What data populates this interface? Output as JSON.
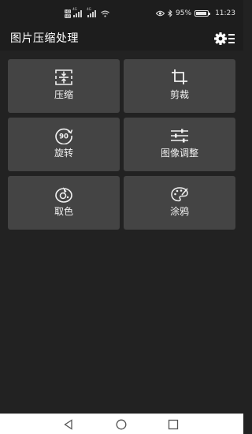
{
  "status_bar": {
    "sim1_badge": "HD",
    "sim2_badge": "HD",
    "network1": "4G",
    "network2": "4G",
    "battery_percent": "95%",
    "battery_level": 0.95,
    "time": "11:23",
    "icons": [
      "signal-icon",
      "wifi-icon",
      "eye-icon",
      "bluetooth-icon",
      "battery-icon"
    ]
  },
  "app_bar": {
    "title": "图片压缩处理",
    "settings_icon": "settings-menu-icon"
  },
  "tiles": [
    {
      "label": "压缩",
      "icon": "compress-icon"
    },
    {
      "label": "剪裁",
      "icon": "crop-icon"
    },
    {
      "label": "旋转",
      "icon": "rotate-90-icon"
    },
    {
      "label": "图像调整",
      "icon": "sliders-icon"
    },
    {
      "label": "取色",
      "icon": "color-picker-icon"
    },
    {
      "label": "涂鸦",
      "icon": "palette-icon"
    }
  ],
  "nav_bar": {
    "buttons": [
      "back-triangle-icon",
      "home-circle-icon",
      "recents-square-icon"
    ]
  },
  "colors": {
    "background": "#222222",
    "bar": "#1d1d1d",
    "tile": "#444444",
    "text": "#ffffff"
  }
}
